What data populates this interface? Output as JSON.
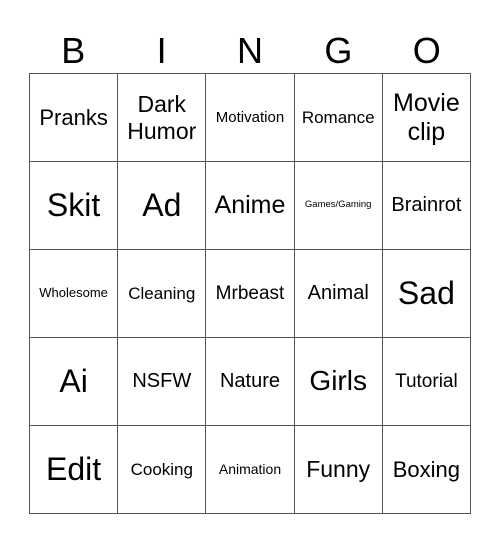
{
  "header": [
    "B",
    "I",
    "N",
    "G",
    "O"
  ],
  "cells": [
    [
      "Pranks",
      "Dark Humor",
      "Motivation",
      "Romance",
      "Movie clip"
    ],
    [
      "Skit",
      "Ad",
      "Anime",
      "Games/Gaming",
      "Brainrot"
    ],
    [
      "Wholesome",
      "Cleaning",
      "Mrbeast",
      "Animal",
      "Sad"
    ],
    [
      "Ai",
      "NSFW",
      "Nature",
      "Girls",
      "Tutorial"
    ],
    [
      "Edit",
      "Cooking",
      "Animation",
      "Funny",
      "Boxing"
    ]
  ]
}
